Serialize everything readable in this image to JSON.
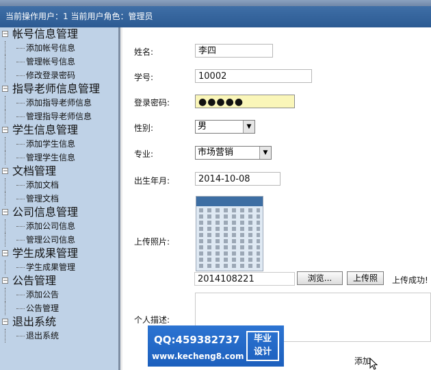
{
  "topbar": {
    "user_info": "当前操作用户：1 当前用户角色：管理员"
  },
  "sidebar": {
    "groups": [
      {
        "title": "帐号信息管理",
        "items": [
          "添加帐号信息",
          "管理帐号信息",
          "修改登录密码"
        ]
      },
      {
        "title": "指导老师信息管理",
        "items": [
          "添加指导老师信息",
          "管理指导老师信息"
        ]
      },
      {
        "title": "学生信息管理",
        "items": [
          "添加学生信息",
          "管理学生信息"
        ]
      },
      {
        "title": "文档管理",
        "items": [
          "添加文档",
          "管理文档"
        ]
      },
      {
        "title": "公司信息管理",
        "items": [
          "添加公司信息",
          "管理公司信息"
        ]
      },
      {
        "title": "学生成果管理",
        "items": [
          "学生成果管理"
        ]
      },
      {
        "title": "公告管理",
        "items": [
          "添加公告",
          "公告管理"
        ]
      },
      {
        "title": "退出系统",
        "items": [
          "退出系统"
        ]
      }
    ]
  },
  "form": {
    "name_label": "姓名:",
    "name_value": "李四",
    "student_id_label": "学号:",
    "student_id_value": "10002",
    "password_label": "登录密码:",
    "password_value": "●●●●●",
    "gender_label": "性别:",
    "gender_value": "男",
    "major_label": "专业:",
    "major_value": "市场营销",
    "birth_label": "出生年月:",
    "birth_value": "2014-10-08",
    "photo_label": "上传照片:",
    "photo_file_value": "2014108221",
    "browse_button": "浏览...",
    "upload_button": "上传照",
    "upload_status": "上传成功!",
    "desc_label": "个人描述:",
    "add_button": "添加"
  },
  "watermark": {
    "qq": "QQ:459382737",
    "site": "www.kecheng8.com",
    "badge_top": "毕业",
    "badge_bottom": "设计"
  }
}
